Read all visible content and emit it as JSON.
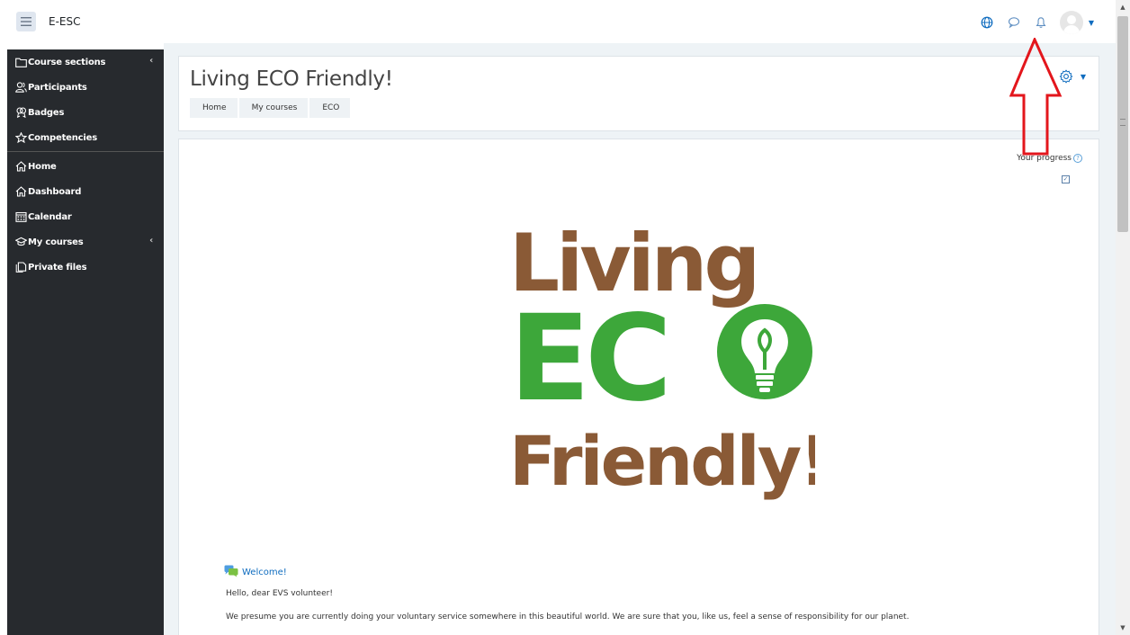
{
  "navbar": {
    "brand": "E-ESC"
  },
  "sidebar": {
    "items": [
      {
        "label": "Course sections",
        "icon": "folder-icon",
        "chevron": "‹"
      },
      {
        "label": "Participants",
        "icon": "users-icon"
      },
      {
        "label": "Badges",
        "icon": "badge-icon"
      },
      {
        "label": "Competencies",
        "icon": "star-icon"
      },
      {
        "label": "Home",
        "icon": "home-icon"
      },
      {
        "label": "Dashboard",
        "icon": "dashboard-icon"
      },
      {
        "label": "Calendar",
        "icon": "calendar-icon"
      },
      {
        "label": "My courses",
        "icon": "graduation-cap-icon",
        "chevron": "‹"
      },
      {
        "label": "Private files",
        "icon": "files-icon"
      }
    ]
  },
  "header": {
    "title": "Living ECO Friendly!",
    "breadcrumb": [
      "Home",
      "My courses",
      "ECO"
    ]
  },
  "content": {
    "progress_label": "Your progress",
    "logo": {
      "line1": "Living",
      "line2": "EC",
      "line3": "Friendly!",
      "brown": "#8a5a36",
      "green": "#3da73a"
    },
    "welcome_link": "Welcome!",
    "greeting": "Hello, dear EVS volunteer!",
    "paragraph": "We presume you are currently doing your voluntary service somewhere in this beautiful world. We are sure that you, like us, feel a sense of responsibility for our planet."
  },
  "colors": {
    "accent": "#0f6cbf",
    "sidebar_bg": "#272a2e",
    "annotation": "#e3161c"
  }
}
